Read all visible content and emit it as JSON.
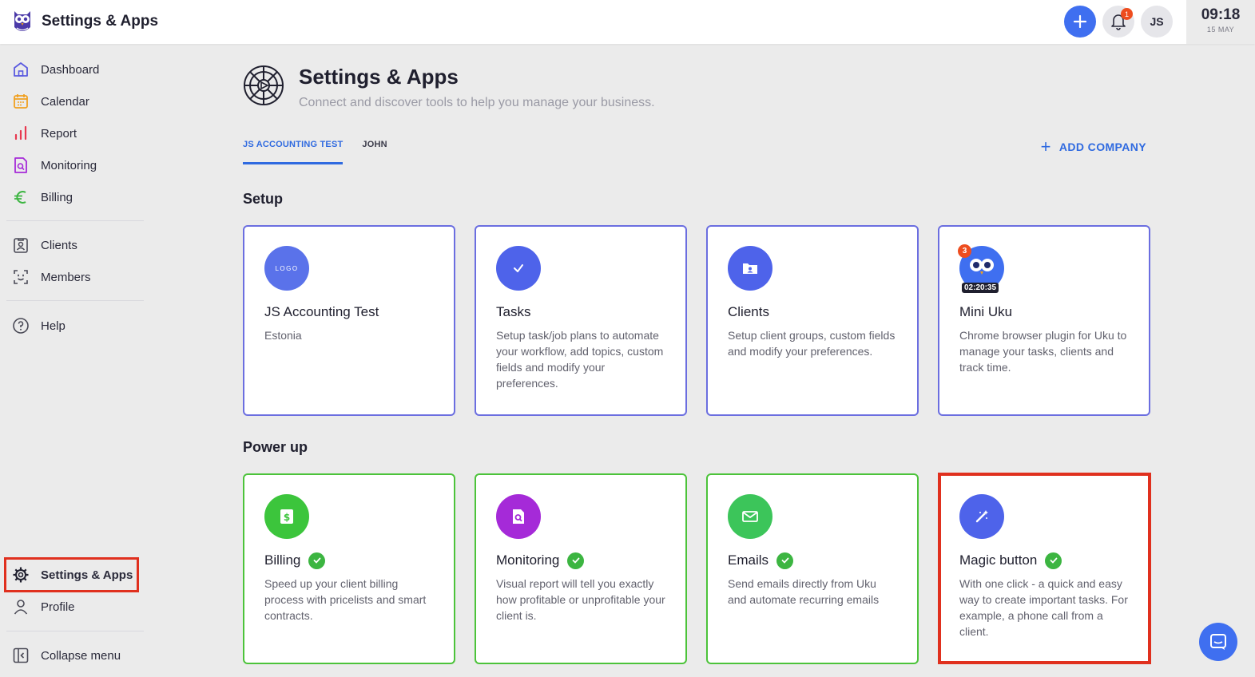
{
  "app": {
    "title": "Settings & Apps"
  },
  "topbar": {
    "notifications_count": "1",
    "avatar_initials": "JS",
    "time": "09:18",
    "date": "15 MAY"
  },
  "sidebar": {
    "items": [
      {
        "label": "Dashboard",
        "icon": "home-icon"
      },
      {
        "label": "Calendar",
        "icon": "calendar-icon"
      },
      {
        "label": "Report",
        "icon": "bar-chart-icon"
      },
      {
        "label": "Monitoring",
        "icon": "document-search-icon"
      },
      {
        "label": "Billing",
        "icon": "euro-icon"
      },
      {
        "label": "Clients",
        "icon": "client-icon"
      },
      {
        "label": "Members",
        "icon": "members-icon"
      },
      {
        "label": "Help",
        "icon": "help-icon"
      }
    ],
    "bottom": [
      {
        "label": "Settings & Apps",
        "icon": "gear-icon",
        "active": true
      },
      {
        "label": "Profile",
        "icon": "person-icon"
      },
      {
        "label": "Collapse menu",
        "icon": "collapse-icon"
      }
    ]
  },
  "page": {
    "title": "Settings & Apps",
    "subtitle": "Connect and discover tools to help you manage your business.",
    "tabs": [
      {
        "label": "JS ACCOUNTING TEST",
        "active": true
      },
      {
        "label": "JOHN",
        "active": false
      }
    ],
    "add_company_label": "ADD COMPANY"
  },
  "setup": {
    "title": "Setup",
    "cards": [
      {
        "title": "JS Accounting Test",
        "desc": "Estonia",
        "icon_text": "LOGO"
      },
      {
        "title": "Tasks",
        "desc": "Setup task/job plans to automate your workflow, add topics, custom fields and modify your preferences."
      },
      {
        "title": "Clients",
        "desc": "Setup client groups, custom fields and modify your preferences."
      },
      {
        "title": "Mini Uku",
        "desc": "Chrome browser plugin for Uku to manage your tasks, clients and track time.",
        "badge": "3",
        "timer": "02:20:35"
      }
    ]
  },
  "power": {
    "title": "Power up",
    "cards": [
      {
        "title": "Billing",
        "desc": "Speed up your client billing process with pricelists and smart contracts.",
        "color": "#3cc53c"
      },
      {
        "title": "Monitoring",
        "desc": "Visual report will tell you exactly how profitable or unprofitable your client is.",
        "color": "#a52ad8"
      },
      {
        "title": "Emails",
        "desc": "Send emails directly from Uku and automate recurring emails",
        "color": "#3cc55a"
      },
      {
        "title": "Magic button",
        "desc": "With one click - a quick and easy way to create important tasks. For example, a phone call from a client.",
        "color": "#4e63ea"
      }
    ]
  },
  "colors": {
    "accent": "#3f6ff0",
    "setup_border": "#6b6ee0",
    "power_border": "#4cc33a",
    "highlight": "#e0301e"
  }
}
